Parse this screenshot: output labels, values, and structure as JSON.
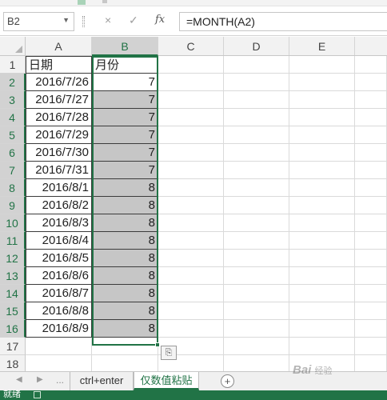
{
  "name_box": {
    "value": "B2"
  },
  "formula_bar": {
    "cancel": "×",
    "confirm": "✓",
    "fx": "fx",
    "formula": "=MONTH(A2)"
  },
  "columns": [
    "A",
    "B",
    "C",
    "D",
    "E"
  ],
  "rows": [
    {
      "num": "1",
      "a": "日期",
      "b": "月份"
    },
    {
      "num": "2",
      "a": "2016/7/26",
      "b": "7"
    },
    {
      "num": "3",
      "a": "2016/7/27",
      "b": "7"
    },
    {
      "num": "4",
      "a": "2016/7/28",
      "b": "7"
    },
    {
      "num": "5",
      "a": "2016/7/29",
      "b": "7"
    },
    {
      "num": "6",
      "a": "2016/7/30",
      "b": "7"
    },
    {
      "num": "7",
      "a": "2016/7/31",
      "b": "7"
    },
    {
      "num": "8",
      "a": "2016/8/1",
      "b": "8"
    },
    {
      "num": "9",
      "a": "2016/8/2",
      "b": "8"
    },
    {
      "num": "10",
      "a": "2016/8/3",
      "b": "8"
    },
    {
      "num": "11",
      "a": "2016/8/4",
      "b": "8"
    },
    {
      "num": "12",
      "a": "2016/8/5",
      "b": "8"
    },
    {
      "num": "13",
      "a": "2016/8/6",
      "b": "8"
    },
    {
      "num": "14",
      "a": "2016/8/7",
      "b": "8"
    },
    {
      "num": "15",
      "a": "2016/8/8",
      "b": "8"
    },
    {
      "num": "16",
      "a": "2016/8/9",
      "b": "8"
    },
    {
      "num": "17",
      "a": "",
      "b": ""
    },
    {
      "num": "18",
      "a": "",
      "b": ""
    }
  ],
  "sheet_tabs": {
    "nav_prev": "◀",
    "nav_next": "▶",
    "ellipsis": "...",
    "tabs": [
      "ctrl+enter",
      "仅数值粘贴"
    ],
    "active_tab": "仅数值粘贴",
    "add": "+"
  },
  "status_bar": {
    "text": "就绪"
  },
  "watermark": {
    "text": "Bai",
    "sub": "经验"
  },
  "colors": {
    "accent": "#217346",
    "selection_fill": "#c6c6c6"
  },
  "icons": [
    "name-box-dropdown-icon",
    "cancel-icon",
    "confirm-icon",
    "function-icon",
    "paste-options-icon",
    "add-sheet-icon",
    "macro-record-icon"
  ]
}
